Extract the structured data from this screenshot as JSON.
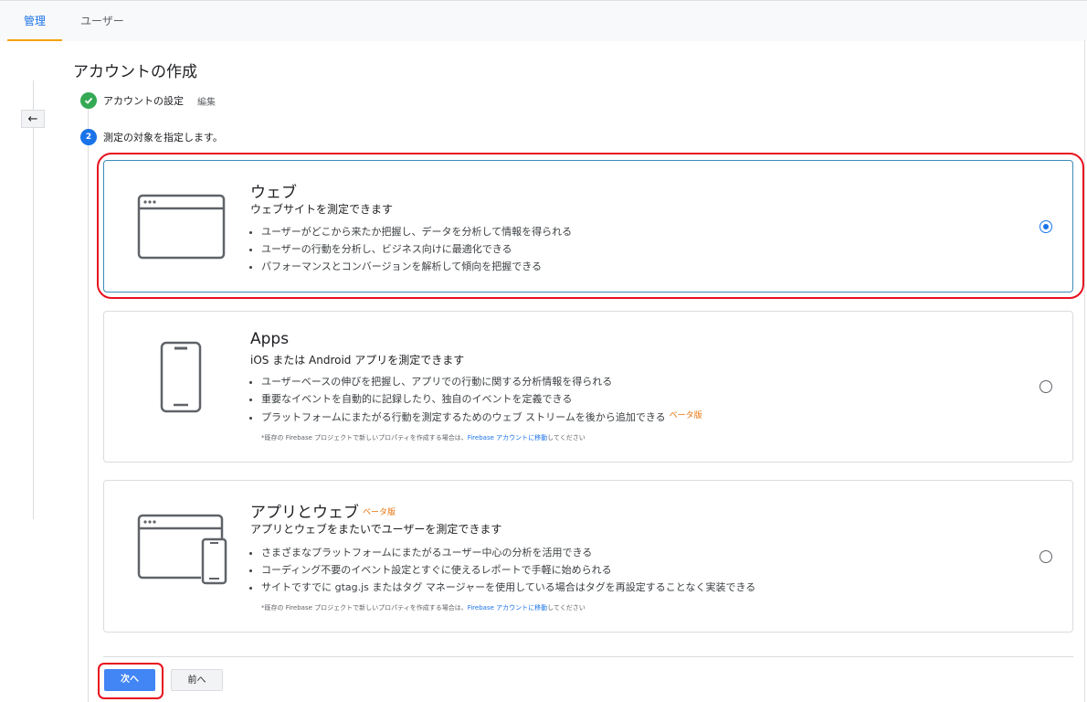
{
  "tabs": {
    "admin": "管理",
    "user": "ユーザー"
  },
  "back_icon": "←",
  "page_title": "アカウントの作成",
  "steps": {
    "step1_label": "アカウントの設定",
    "step1_edit": "編集",
    "step2_number": "2",
    "step2_label": "測定の対象を指定します。"
  },
  "options": [
    {
      "title": "ウェブ",
      "subtitle": "ウェブサイトを測定できます",
      "bullets": [
        "ユーザーがどこから来たか把握し、データを分析して情報を得られる",
        "ユーザーの行動を分析し、ビジネス向けに最適化できる",
        "パフォーマンスとコンバージョンを解析して傾向を把握できる"
      ],
      "selected": true,
      "icon": "browser-window-icon"
    },
    {
      "title": "Apps",
      "subtitle": "iOS または Android アプリを測定できます",
      "bullets": [
        "ユーザーベースの伸びを把握し、アプリでの行動に関する分析情報を得られる",
        "重要なイベントを自動的に記録したり、独自のイベントを定義できる",
        "プラットフォームにまたがる行動を測定するためのウェブ ストリームを後から追加できる"
      ],
      "beta": "ベータ版",
      "note_prefix": "*既存の Firebase プロジェクトで新しいプロパティを作成する場合は、",
      "note_link": "Firebase アカウントに移動",
      "note_suffix": "してください",
      "selected": false,
      "icon": "smartphone-icon"
    },
    {
      "title": "アプリとウェブ",
      "title_beta": "ベータ版",
      "subtitle": "アプリとウェブをまたいでユーザーを測定できます",
      "bullets": [
        "さまざまなプラットフォームにまたがるユーザー中心の分析を活用できる",
        "コーディング不要のイベント設定とすぐに使えるレポートで手軽に始められる",
        "サイトですでに gtag.js またはタグ マネージャーを使用している場合はタグを再設定することなく実装できる"
      ],
      "note_prefix": "*既存の Firebase プロジェクトで新しいプロパティを作成する場合は、",
      "note_link": "Firebase アカウントに移動",
      "note_suffix": "してください",
      "selected": false,
      "icon": "browser-and-phone-icon"
    }
  ],
  "buttons": {
    "next": "次へ",
    "prev": "前へ"
  },
  "colors": {
    "accent": "#1a73e8",
    "check": "#34a853",
    "highlight": "#e8101e",
    "beta": "#e8710a",
    "next_button": "#4285f4"
  }
}
